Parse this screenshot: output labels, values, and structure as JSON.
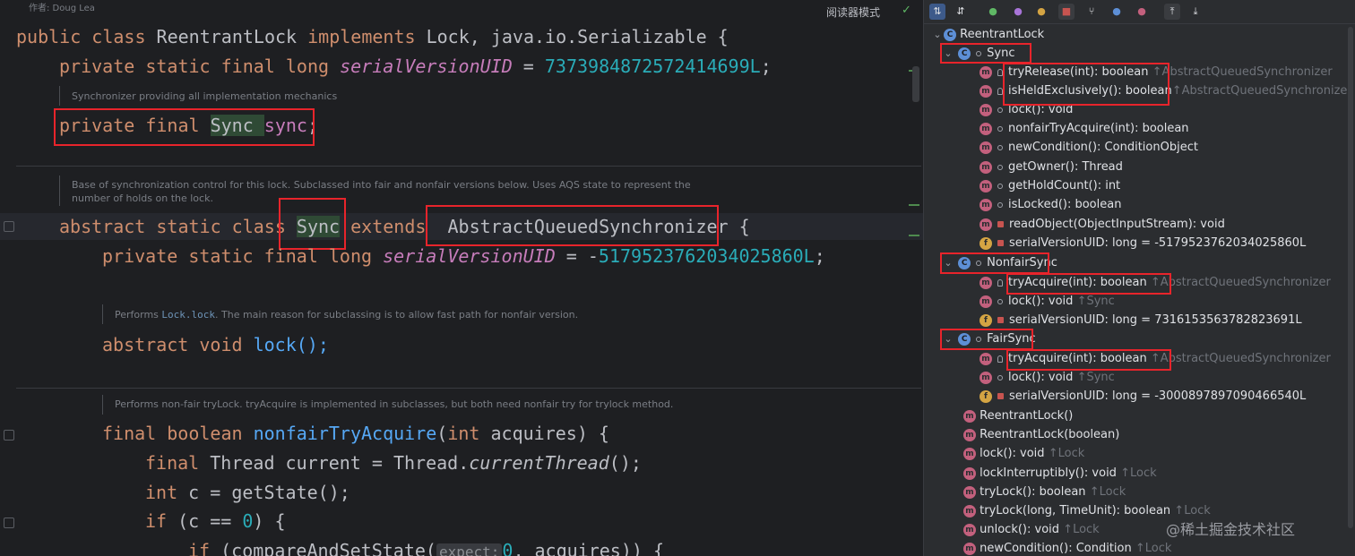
{
  "editor": {
    "author_note": "作者: Doug Lea",
    "reader_mode": "阅读器模式",
    "lines": {
      "l1": {
        "kw1": "public class ",
        "name": "ReentrantLock ",
        "kw2": "implements ",
        "rest": "Lock, java.io.Serializable {"
      },
      "l2": {
        "kw": "private static final long ",
        "field": "serialVersionUID",
        "eq": " = ",
        "num": "7373984872572414699L",
        ";": ";"
      },
      "doc1": "Synchronizer providing all implementation mechanics",
      "l3": {
        "kw": "private final ",
        "type": "Sync ",
        "field": "sync",
        ";": ";"
      },
      "doc2a": "Base of synchronization control for this lock. Subclassed into fair and nonfair versions below. Uses AQS state to represent the",
      "doc2b": "number of holds on the lock.",
      "l4": {
        "kw1": "abstract static class ",
        "name": "Sync",
        "kw2": " extends ",
        "sup": "AbstractQueuedSynchronizer",
        " {": " {"
      },
      "l5": {
        "kw": "private static final long ",
        "field": "serialVersionUID",
        "eq": " = -",
        "num": "5179523762034025860L",
        ";": ";"
      },
      "doc3a": "Performs ",
      "doc3ref": "Lock.lock",
      "doc3b": ". The main reason for subclassing is to allow fast path for nonfair version.",
      "l6": {
        "kw": "abstract void ",
        "rest": "lock();"
      },
      "doc4": "Performs non-fair tryLock. tryAcquire is implemented in subclasses, but both need nonfair try for trylock method.",
      "l7": {
        "kw": "final boolean ",
        "fn": "nonfairTryAcquire",
        "p1": "(",
        "kw2": "int ",
        "rest": "acquires) {"
      },
      "l8": {
        "kw": "final ",
        "t": "Thread current = Thread.",
        "m": "currentThread",
        "rest": "();"
      },
      "l9": {
        "kw": "int ",
        "rest": "c = getState();"
      },
      "l10": {
        "kw": "if ",
        "p": "(c == ",
        "num": "0",
        ") {": ") {"
      },
      "l11": {
        "kw": "if ",
        "p": "(compareAndSetState(",
        "hint": "expect:",
        "num": "0",
        ",": ", acquires)) {"
      }
    }
  },
  "structure": {
    "root": "ReentrantLock",
    "groups": [
      {
        "name": "Sync",
        "items": [
          {
            "icon": "m",
            "vis": "key",
            "label": "tryRelease(int): boolean",
            "inh": "↑AbstractQueuedSynchronizer"
          },
          {
            "icon": "m",
            "vis": "key",
            "label": "isHeldExclusively(): boolean",
            "inh": "↑AbstractQueuedSynchronizer"
          },
          {
            "icon": "m",
            "vis": "pkg",
            "label": "lock(): void",
            "inh": ""
          },
          {
            "icon": "m",
            "vis": "pkg",
            "label": "nonfairTryAcquire(int): boolean",
            "inh": ""
          },
          {
            "icon": "m",
            "vis": "pkg",
            "label": "newCondition(): ConditionObject",
            "inh": ""
          },
          {
            "icon": "m",
            "vis": "pkg",
            "label": "getOwner(): Thread",
            "inh": ""
          },
          {
            "icon": "m",
            "vis": "pkg",
            "label": "getHoldCount(): int",
            "inh": ""
          },
          {
            "icon": "m",
            "vis": "pkg",
            "label": "isLocked(): boolean",
            "inh": ""
          },
          {
            "icon": "m",
            "vis": "lock",
            "label": "readObject(ObjectInputStream): void",
            "inh": ""
          },
          {
            "icon": "f",
            "vis": "lock",
            "label": "serialVersionUID: long = -5179523762034025860L",
            "inh": ""
          }
        ]
      },
      {
        "name": "NonfairSync",
        "items": [
          {
            "icon": "m",
            "vis": "key",
            "label": "tryAcquire(int): boolean",
            "inh": "↑AbstractQueuedSynchronizer"
          },
          {
            "icon": "m",
            "vis": "pkg",
            "label": "lock(): void",
            "inh": "↑Sync"
          },
          {
            "icon": "f",
            "vis": "lock",
            "label": "serialVersionUID: long = 7316153563782823691L",
            "inh": ""
          }
        ]
      },
      {
        "name": "FairSync",
        "items": [
          {
            "icon": "m",
            "vis": "key",
            "label": "tryAcquire(int): boolean",
            "inh": "↑AbstractQueuedSynchronizer"
          },
          {
            "icon": "m",
            "vis": "pkg",
            "label": "lock(): void",
            "inh": "↑Sync"
          },
          {
            "icon": "f",
            "vis": "lock",
            "label": "serialVersionUID: long = -3000897897090466540L",
            "inh": ""
          }
        ]
      }
    ],
    "members": [
      {
        "label": "ReentrantLock()",
        "inh": ""
      },
      {
        "label": "ReentrantLock(boolean)",
        "inh": ""
      },
      {
        "label": "lock(): void",
        "inh": "↑Lock"
      },
      {
        "label": "lockInterruptibly(): void",
        "inh": "↑Lock"
      },
      {
        "label": "tryLock(): boolean",
        "inh": "↑Lock"
      },
      {
        "label": "tryLock(long, TimeUnit): boolean",
        "inh": "↑Lock"
      },
      {
        "label": "unlock(): void",
        "inh": "↑Lock"
      },
      {
        "label": "newCondition(): Condition",
        "inh": "↑Lock"
      }
    ],
    "watermark": "@稀土掘金技术社区"
  },
  "toolbar": {
    "icons": [
      "sort-alpha-icon",
      "sort-type-icon",
      "show-inherited-icon",
      "show-properties-icon",
      "show-fields-icon",
      "show-nonpublic-icon",
      "show-anonymous-icon",
      "show-lambdas-icon",
      "show-lambda-icon",
      "expand-all-icon",
      "collapse-all-icon"
    ]
  },
  "colors": {
    "redbox": "#e8242b",
    "bg": "#1e1f22",
    "panel": "#2b2d30"
  }
}
